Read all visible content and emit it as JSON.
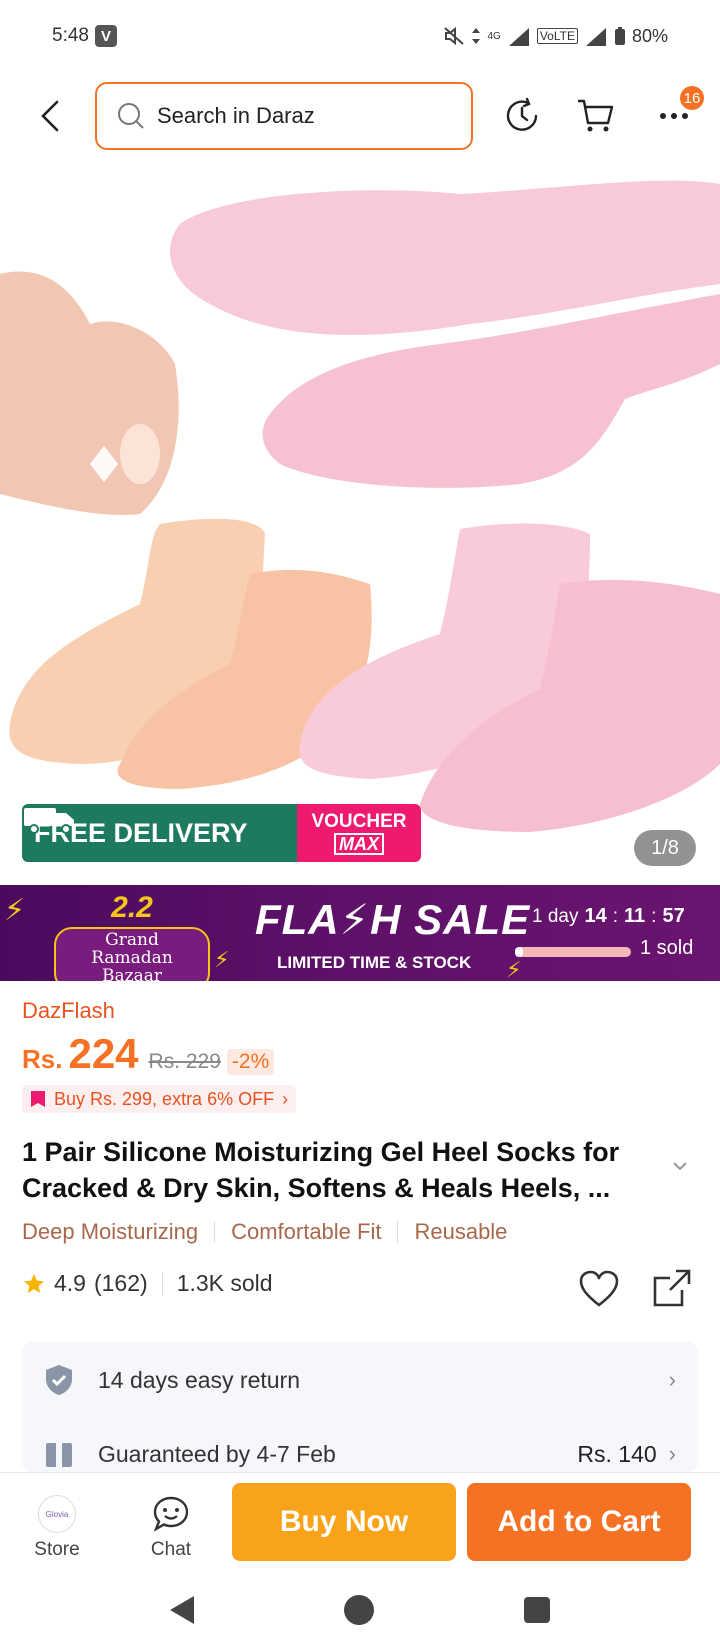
{
  "status": {
    "time": "5:48",
    "carrier_badge": "V",
    "network": "4G",
    "volte": "VoLTE",
    "battery": "80%"
  },
  "header": {
    "search_placeholder": "Search in Daraz",
    "more_badge": "16",
    "icons": [
      "back-icon",
      "search-icon",
      "history-icon",
      "cart-icon",
      "more-icon"
    ]
  },
  "gallery": {
    "free_delivery": "FREE DELIVERY",
    "free_tag": "FREE",
    "voucher_line1": "VOUCHER",
    "voucher_line2": "MAX",
    "counter": "1/8"
  },
  "flash_sale": {
    "campaign_number": "2.2",
    "campaign_line1": "Grand Ramadan",
    "campaign_line2": "Bazaar",
    "title": "FLA⚡H SALE",
    "subtitle": "LIMITED TIME & STOCK",
    "timer_days": "1 day",
    "timer_hours": "14",
    "timer_minutes": "11",
    "timer_seconds": "57",
    "sold": "1 sold",
    "sold_progress": 0.07
  },
  "product": {
    "seller": "DazFlash",
    "currency": "Rs.",
    "price": "224",
    "old_price": "Rs. 229",
    "discount": "-2%",
    "deal": "Buy Rs. 299, extra 6% OFF",
    "title": "1 Pair Silicone Moisturizing Gel Heel Socks for Cracked & Dry Skin, Softens & Heals Heels, ...",
    "tags": [
      "Deep Moisturizing",
      "Comfortable Fit",
      "Reusable"
    ],
    "rating": "4.9",
    "review_count": "(162)",
    "sold_count": "1.3K sold"
  },
  "services": {
    "return": "14 days easy return",
    "delivery": "Guaranteed by 4-7 Feb",
    "delivery_fee": "Rs. 140"
  },
  "actions": {
    "store_label": "Store",
    "store_logo_text": "Glovia",
    "chat_label": "Chat",
    "buy_now": "Buy Now",
    "add_to_cart": "Add to Cart"
  },
  "colors": {
    "accent": "#f57224",
    "buy_now": "#f9a31a",
    "free_delivery": "#1e7a5e",
    "voucher": "#ee1a6f",
    "flash_bg": "#5e1168"
  }
}
